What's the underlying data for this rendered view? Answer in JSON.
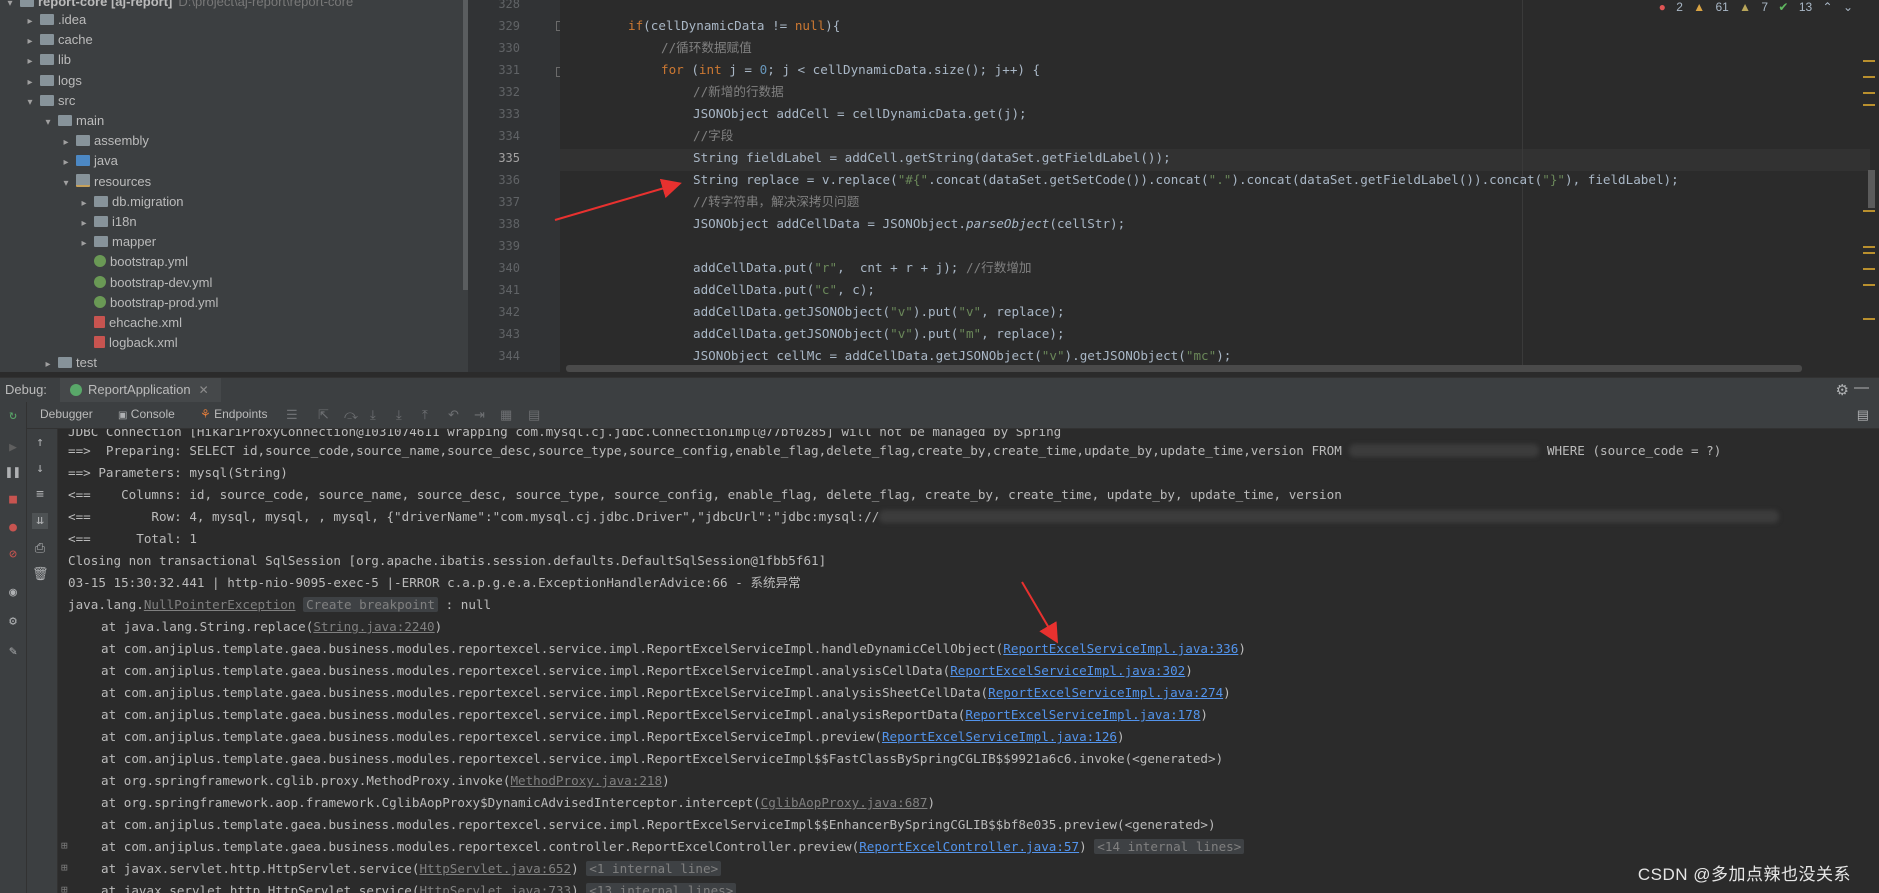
{
  "project_tree": {
    "root": "report-core [aj-report]",
    "root_path": "D:\\project\\aj-report\\report-core",
    "items": [
      {
        "label": ".idea",
        "kind": "folder"
      },
      {
        "label": "cache",
        "kind": "folder"
      },
      {
        "label": "lib",
        "kind": "folder"
      },
      {
        "label": "logs",
        "kind": "folder"
      },
      {
        "label": "src",
        "kind": "folder"
      },
      {
        "label": "main",
        "kind": "folder"
      },
      {
        "label": "assembly",
        "kind": "folder"
      },
      {
        "label": "java",
        "kind": "folder-blue"
      },
      {
        "label": "resources",
        "kind": "folder-res"
      },
      {
        "label": "db.migration",
        "kind": "folder"
      },
      {
        "label": "i18n",
        "kind": "folder"
      },
      {
        "label": "mapper",
        "kind": "folder"
      },
      {
        "label": "bootstrap.yml",
        "kind": "yml"
      },
      {
        "label": "bootstrap-dev.yml",
        "kind": "yml"
      },
      {
        "label": "bootstrap-prod.yml",
        "kind": "yml"
      },
      {
        "label": "ehcache.xml",
        "kind": "xml"
      },
      {
        "label": "logback.xml",
        "kind": "xml"
      },
      {
        "label": "test",
        "kind": "folder"
      }
    ]
  },
  "inspections": {
    "errors": "2",
    "warnings": "61",
    "weak_warnings": "7",
    "ok": "13"
  },
  "editor": {
    "line_numbers": [
      "328",
      "329",
      "330",
      "331",
      "332",
      "333",
      "334",
      "335",
      "336",
      "337",
      "338",
      "339",
      "340",
      "341",
      "342",
      "343",
      "344"
    ],
    "current_line": "335"
  },
  "debug": {
    "title": "Debug:",
    "config": "ReportApplication",
    "tabs": {
      "debugger": "Debugger",
      "console": "Console",
      "endpoints": "Endpoints"
    }
  },
  "console": {
    "l0": "JDBC Connection [HikariProxyConnection@1031074611 wrapping com.mysql.cj.jdbc.ConnectionImpl@77bf0285] will not be managed by Spring",
    "l1a": "==>  Preparing: SELECT id,source_code,source_name,source_desc,source_type,source_config,enable_flag,delete_flag,create_by,create_time,update_by,update_time,version FROM ",
    "l1b": " WHERE (source_code = ?)",
    "l2": "==> Parameters: mysql(String)",
    "l3": "<==    Columns: id, source_code, source_name, source_desc, source_type, source_config, enable_flag, delete_flag, create_by, create_time, update_by, update_time, version",
    "l4": "<==        Row: 4, mysql, mysql, , mysql, {\"driverName\":\"com.mysql.cj.jdbc.Driver\",\"jdbcUrl\":\"jdbc:mysql://",
    "l5": "<==      Total: 1",
    "l6": "Closing non transactional SqlSession [org.apache.ibatis.session.defaults.DefaultSqlSession@1fbb5f61]",
    "l7": "03-15 15:30:32.441 | http-nio-9095-exec-5 |-ERROR c.a.p.g.e.a.ExceptionHandlerAdvice:66 - 系统异常",
    "exc_prefix": "java.lang.",
    "exc_name": "NullPointerException",
    "exc_badge": "Create breakpoint",
    "exc_suffix": " : null",
    "frames": [
      {
        "pre": "at java.lang.String.replace(",
        "link": "String.java:2240",
        "post": ")",
        "gray": true
      },
      {
        "pre": "at com.anjiplus.template.gaea.business.modules.reportexcel.service.impl.ReportExcelServiceImpl.handleDynamicCellObject(",
        "link": "ReportExcelServiceImpl.java:336",
        "post": ")",
        "gray": false
      },
      {
        "pre": "at com.anjiplus.template.gaea.business.modules.reportexcel.service.impl.ReportExcelServiceImpl.analysisCellData(",
        "link": "ReportExcelServiceImpl.java:302",
        "post": ")",
        "gray": false
      },
      {
        "pre": "at com.anjiplus.template.gaea.business.modules.reportexcel.service.impl.ReportExcelServiceImpl.analysisSheetCellData(",
        "link": "ReportExcelServiceImpl.java:274",
        "post": ")",
        "gray": false
      },
      {
        "pre": "at com.anjiplus.template.gaea.business.modules.reportexcel.service.impl.ReportExcelServiceImpl.analysisReportData(",
        "link": "ReportExcelServiceImpl.java:178",
        "post": ")",
        "gray": false
      },
      {
        "pre": "at com.anjiplus.template.gaea.business.modules.reportexcel.service.impl.ReportExcelServiceImpl.preview(",
        "link": "ReportExcelServiceImpl.java:126",
        "post": ")",
        "gray": false
      },
      {
        "pre": "at com.anjiplus.template.gaea.business.modules.reportexcel.service.impl.ReportExcelServiceImpl$$FastClassBySpringCGLIB$$9921a6c6.invoke(<generated>)",
        "link": "",
        "post": "",
        "gray": false
      },
      {
        "pre": "at org.springframework.cglib.proxy.MethodProxy.invoke(",
        "link": "MethodProxy.java:218",
        "post": ")",
        "gray": true
      },
      {
        "pre": "at org.springframework.aop.framework.CglibAopProxy$DynamicAdvisedInterceptor.intercept(",
        "link": "CglibAopProxy.java:687",
        "post": ")",
        "gray": true
      },
      {
        "pre": "at com.anjiplus.template.gaea.business.modules.reportexcel.service.impl.ReportExcelServiceImpl$$EnhancerBySpringCGLIB$$bf8e035.preview(<generated>)",
        "link": "",
        "post": "",
        "gray": false
      },
      {
        "pre": "at com.anjiplus.template.gaea.business.modules.reportexcel.controller.ReportExcelController.preview(",
        "link": "ReportExcelController.java:57",
        "post": ") ",
        "gray": false,
        "badge": "<14 internal lines>"
      },
      {
        "pre": "at javax.servlet.http.HttpServlet.service(",
        "link": "HttpServlet.java:652",
        "post": ") ",
        "gray": true,
        "badge": "<1 internal line>"
      },
      {
        "pre": "at javax.servlet.http.HttpServlet.service(",
        "link": "HttpServlet.java:733",
        "post": ") ",
        "gray": true,
        "badge": "<13 internal lines>"
      }
    ]
  },
  "watermark": "CSDN @多加点辣也没关系",
  "colors": {
    "accent_arrow": "#e8312f",
    "link": "#5394ec",
    "keyword": "#cc7832",
    "comment": "#808080",
    "string": "#6a8759"
  }
}
